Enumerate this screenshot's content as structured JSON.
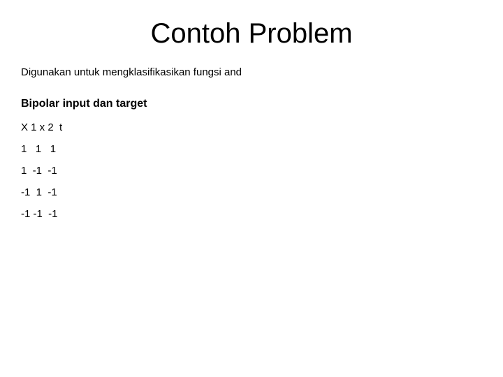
{
  "title": "Contoh Problem",
  "subtitle": "Digunakan untuk mengklasifikasikan fungsi and",
  "section": "Bipolar input dan target",
  "rows": [
    "X 1 x 2  t",
    "1   1   1",
    "1  -1  -1",
    "-1  1  -1",
    "-1 -1  -1"
  ]
}
